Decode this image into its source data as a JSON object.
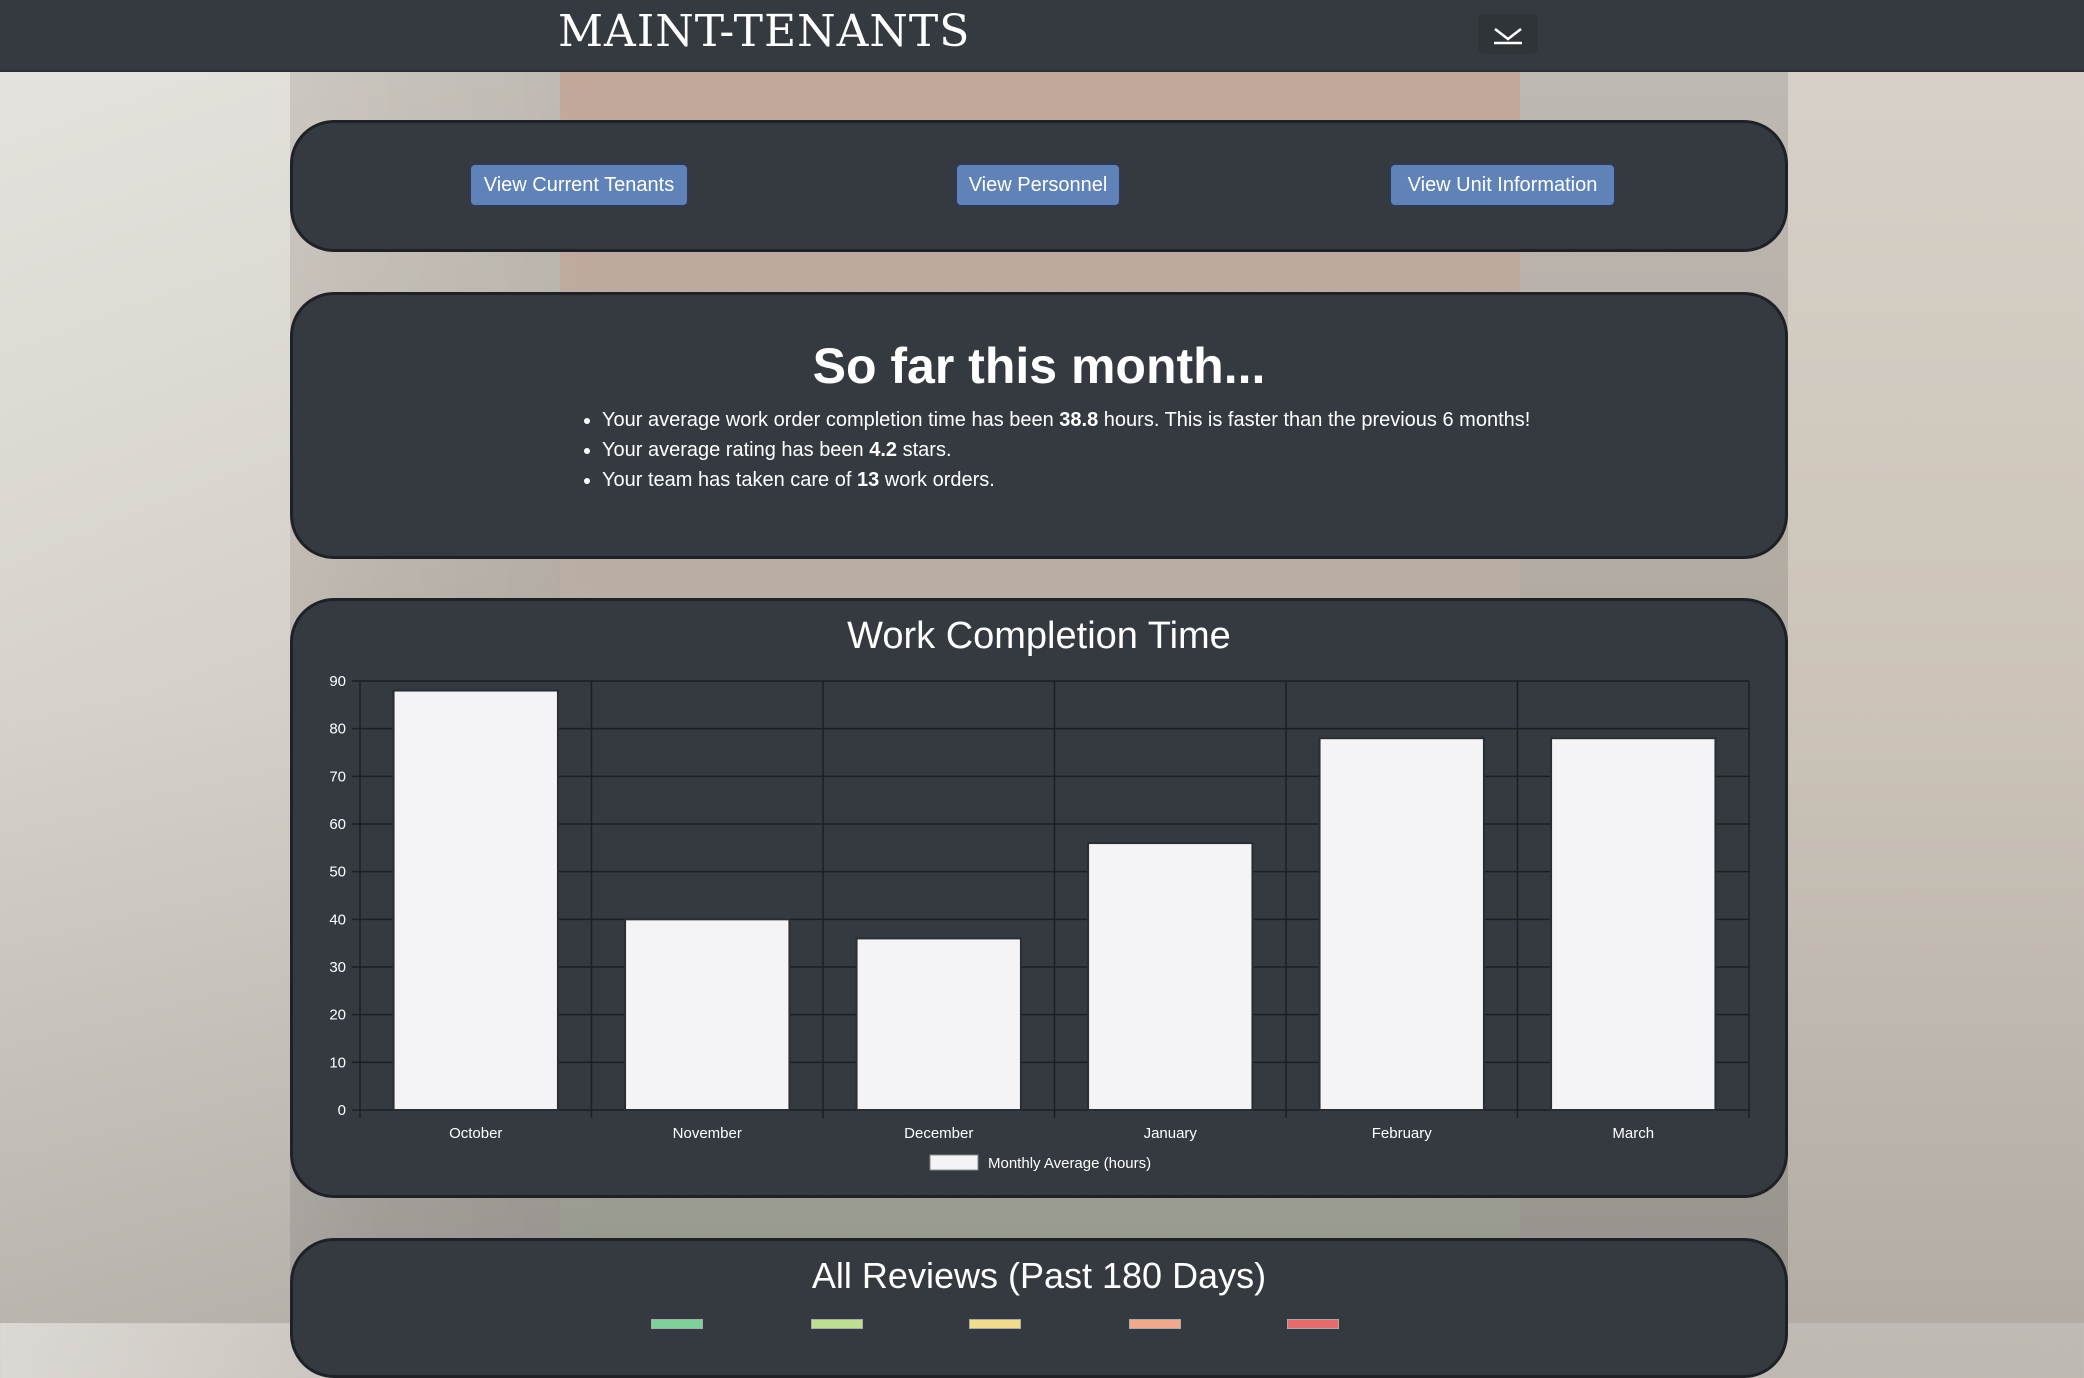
{
  "navbar": {
    "brand": "MAINT-TENANTS",
    "toggle_icon": "chevron-down-icon"
  },
  "actions": {
    "tenants_label": "View Current Tenants",
    "personnel_label": "View Personnel",
    "units_label": "View Unit Information"
  },
  "summary": {
    "title": "So far this month...",
    "line1_pre": "Your average work order completion time has been ",
    "line1_value": "38.8",
    "line1_post": " hours. This is faster than the previous 6 months!",
    "line2_pre": "Your average rating has been ",
    "line2_value": "4.2",
    "line2_post": " stars.",
    "line3_pre": "Your team has taken care of ",
    "line3_value": "13",
    "line3_post": " work orders."
  },
  "colors": {
    "panel": "#343a40",
    "button": "#5f82b8",
    "bar_fill": "#f4f4f7"
  },
  "chart_data": {
    "type": "bar",
    "title": "Work Completion Time",
    "categories": [
      "October",
      "November",
      "December",
      "January",
      "February",
      "March"
    ],
    "series": [
      {
        "name": "Monthly Average (hours)",
        "values": [
          88,
          40,
          36,
          56,
          78,
          78
        ]
      }
    ],
    "ylim": [
      0,
      90
    ],
    "yticks": [
      0,
      10,
      20,
      30,
      40,
      50,
      60,
      70,
      80,
      90
    ],
    "grid": true,
    "legend": "bottom"
  },
  "reviews": {
    "title": "All Reviews (Past 180 Days)"
  }
}
